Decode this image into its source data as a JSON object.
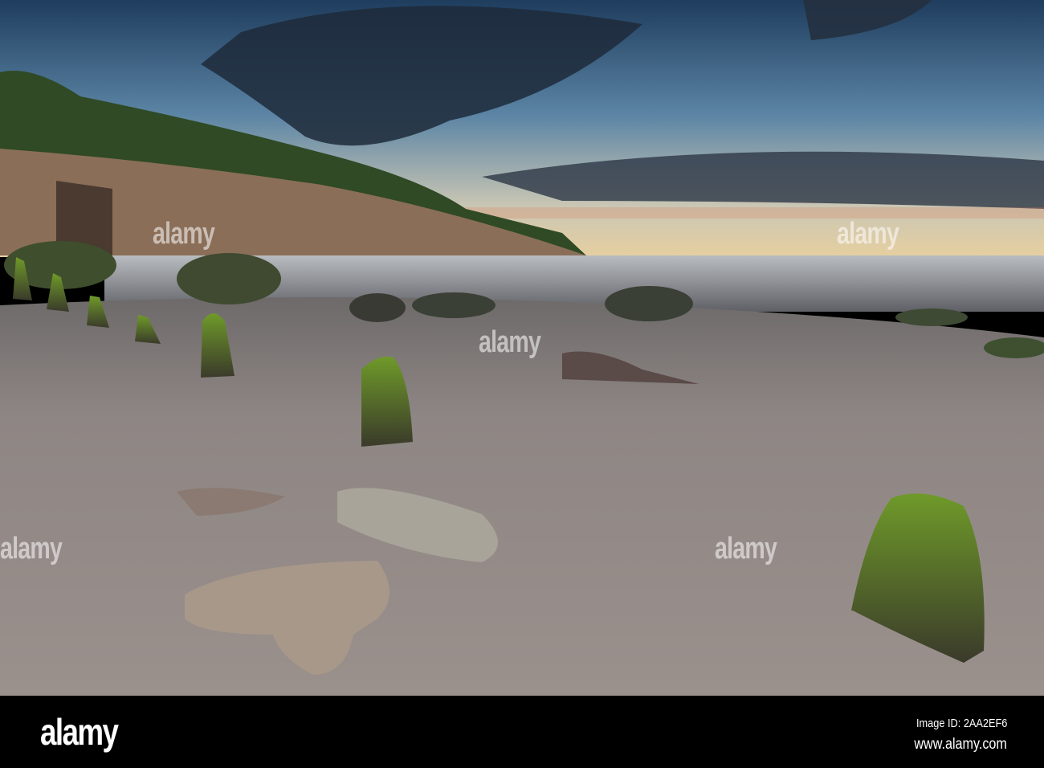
{
  "scene": {
    "description_colors": {
      "sky_top": "#2a4a6a",
      "sky_horizon": "#e8d8b0",
      "sand": "#8c8480",
      "moss": "#5f8a2a",
      "sea": "#9aa4ae"
    }
  },
  "watermark": {
    "text": "alamy"
  },
  "footer": {
    "logo": "alamy",
    "image_id": "Image ID: 2AA2EF6",
    "website": "www.alamy.com"
  }
}
